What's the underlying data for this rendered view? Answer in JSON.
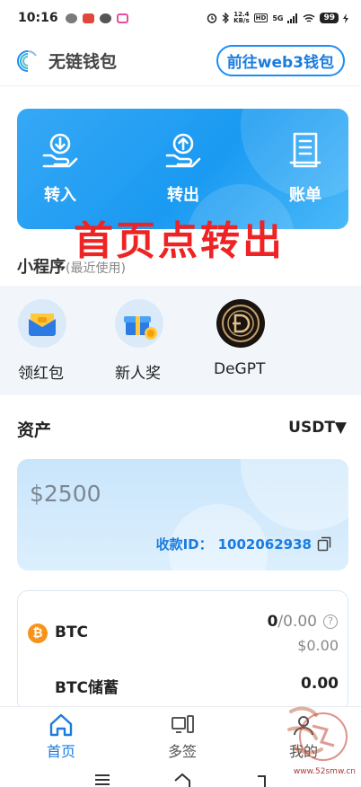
{
  "status_bar": {
    "time": "10:16",
    "net_speed_value": "12.4",
    "net_speed_unit": "KB/s",
    "hd": "HD",
    "signal": "5G",
    "battery": "99"
  },
  "header": {
    "title": "无链钱包",
    "web3_button": "前往web3钱包"
  },
  "actions": [
    {
      "label": "转入",
      "icon": "transfer-in-icon"
    },
    {
      "label": "转出",
      "icon": "transfer-out-icon"
    },
    {
      "label": "账单",
      "icon": "bill-icon"
    }
  ],
  "overlay_text": "首页点转出",
  "mini_programs": {
    "title": "小程序",
    "subtitle": "(最近使用)",
    "items": [
      {
        "label": "领红包",
        "icon": "red-packet-icon"
      },
      {
        "label": "新人奖",
        "icon": "gift-icon"
      },
      {
        "label": "DeGPT",
        "icon": "degpt-logo-icon"
      }
    ]
  },
  "assets": {
    "title": "资产",
    "currency": "USDT▼",
    "balance": "$2500",
    "receive_label": "收款ID：",
    "receive_id": "1002062938"
  },
  "coins": [
    {
      "symbol": "BTC",
      "icon_glyph": "₿",
      "available": "0",
      "total": "/0.00",
      "fiat": "$0.00",
      "help_glyph": "?"
    }
  ],
  "savings": {
    "name": "BTC储蓄",
    "amount": "0.00"
  },
  "tabs": [
    {
      "label": "首页",
      "active": true
    },
    {
      "label": "多签",
      "active": false
    },
    {
      "label": "我的",
      "active": false
    }
  ],
  "watermark": {
    "site": "www.52smw.cn"
  },
  "colors": {
    "accent": "#1b8ef5",
    "overlay": "#ee2323",
    "btc": "#f7931a"
  }
}
